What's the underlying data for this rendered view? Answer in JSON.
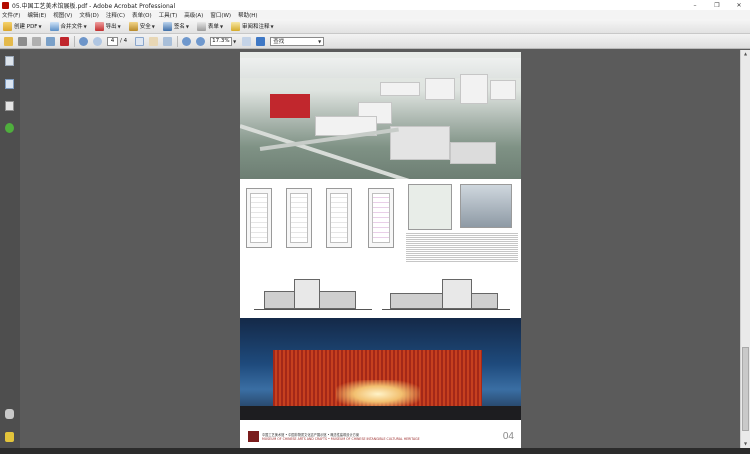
{
  "window": {
    "title": "05.中国工艺美术馆展板.pdf - Adobe Acrobat Professional",
    "minimize": "–",
    "maximize": "❐",
    "close": "✕"
  },
  "menu": [
    "文件(F)",
    "编辑(E)",
    "视图(V)",
    "文档(D)",
    "注释(C)",
    "表单(O)",
    "工具(T)",
    "高级(A)",
    "窗口(W)",
    "帮助(H)"
  ],
  "toolbar1": {
    "create_pdf": "创建 PDF",
    "combine": "合并文件",
    "export": "导出",
    "secure": "安全",
    "sign": "签名",
    "forms": "表单",
    "review": "审阅和注释"
  },
  "toolbar2": {
    "current_page": "4",
    "total_pages": "/ 4",
    "zoom": "17.3%",
    "find_placeholder": "查找"
  },
  "page_content": {
    "footer_line1": "中国工艺美术馆 • 中国非物质文化遗产展示馆 • 概念性建筑设计方案",
    "footer_line2": "MUSEUM OF CHINESE ARTS AND CRAFTS • MUSEUM OF CHINESE INTANGIBLE CULTURAL HERITAGE",
    "page_number": "04"
  },
  "colors": {
    "accent_red": "#c1272d",
    "nav_bg": "#4e4e4e",
    "doc_bg": "#5b5b5b"
  }
}
